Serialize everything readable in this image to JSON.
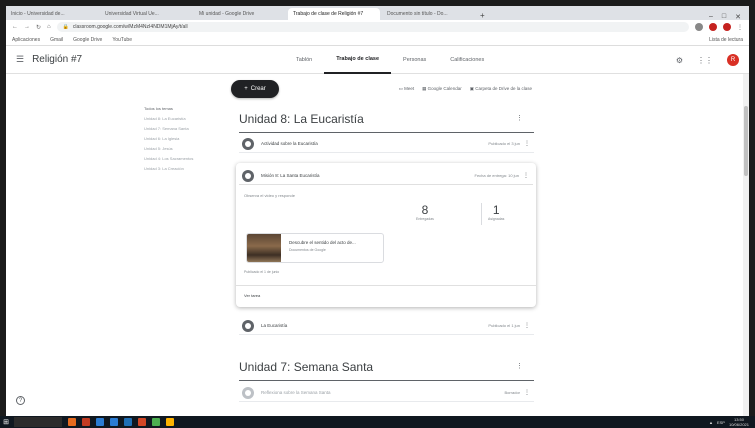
{
  "browser": {
    "tabs": [
      {
        "label": "Inicio - Universidad de...",
        "active": false
      },
      {
        "label": "Universidad Virtual Ue...",
        "active": false
      },
      {
        "label": "Mi unidad - Google Drive",
        "active": false
      },
      {
        "label": "Trabajo de clase de Religión #7",
        "active": true
      },
      {
        "label": "Documento sin título - Do...",
        "active": false
      }
    ],
    "url": "classroom.google.com/w/MzM4NzI4NDM1MjAy/t/all",
    "bookmarks": [
      "Aplicaciones",
      "Gmail",
      "Google Drive",
      "YouTube"
    ],
    "reading_list": "Lista de lectura"
  },
  "app": {
    "class_title": "Religión #7",
    "nav_tabs": [
      {
        "label": "Tablón",
        "active": false
      },
      {
        "label": "Trabajo de clase",
        "active": true
      },
      {
        "label": "Personas",
        "active": false
      },
      {
        "label": "Calificaciones",
        "active": false
      }
    ],
    "avatar_letter": "R",
    "accent": "#d93025"
  },
  "topics": [
    "Todos los temas",
    "Unidad 8: La Eucaristía",
    "Unidad 7: Semana Santa",
    "Unidad 6: La Iglesia",
    "Unidad 5: Jesús",
    "Unidad 4: Los Sacramentos",
    "Unidad 3: La Creación"
  ],
  "toolbar": {
    "create_label": "Crear",
    "meet_label": "Meet",
    "calendar_label": "Google Calendar",
    "drive_label": "Carpeta de Drive de la clase"
  },
  "unit8": {
    "title": "Unidad 8: La Eucaristía",
    "item1": {
      "title": "Actividad sobre la Eucaristía",
      "date": "Publicado el 3 jun"
    },
    "card": {
      "title": "Misión 8: La Santa Eucaristía",
      "date": "Fecha de entrega: 10 jun",
      "description": "Observa el video y responde",
      "assigned": "8",
      "assigned_label": "Entregadas",
      "handed": "1",
      "handed_label": "Asignadas",
      "attachment_title": "Descubre el sentido del acto de...",
      "attachment_sub": "Documentos de Google",
      "posted": "Publicado el 1 de junio",
      "view_label": "Ver tarea"
    },
    "item3": {
      "title": "La Eucaristía",
      "date": "Publicado el 1 jun"
    }
  },
  "unit7": {
    "title": "Unidad 7: Semana Santa",
    "item1": {
      "title": "Reflexiona sobre la Semana Santa",
      "date": "Borrador"
    }
  },
  "taskbar": {
    "time": "13:50",
    "date": "10/06/2021",
    "lang": "ESP"
  }
}
